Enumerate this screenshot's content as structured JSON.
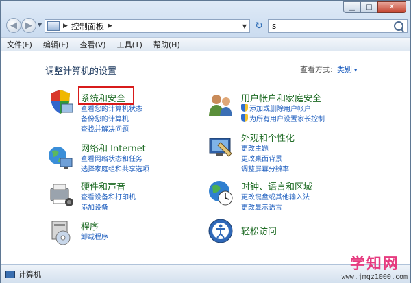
{
  "window": {
    "buttons": [
      "minimize",
      "maximize",
      "close"
    ]
  },
  "address": {
    "path": "控制面板",
    "search_value": "s"
  },
  "menu": [
    "文件(F)",
    "编辑(E)",
    "查看(V)",
    "工具(T)",
    "帮助(H)"
  ],
  "content": {
    "heading": "调整计算机的设置",
    "view_by_label": "查看方式:",
    "view_by_value": "类别",
    "categories": [
      {
        "title": "系统和安全",
        "icon": "system-security-icon",
        "links": [
          "查看您的计算机状态",
          "备份您的计算机",
          "查找并解决问题"
        ]
      },
      {
        "title": "网络和 Internet",
        "icon": "network-icon",
        "links": [
          "查看网络状态和任务",
          "选择家庭组和共享选项"
        ]
      },
      {
        "title": "硬件和声音",
        "icon": "hardware-sound-icon",
        "links": [
          "查看设备和打印机",
          "添加设备"
        ]
      },
      {
        "title": "程序",
        "icon": "programs-icon",
        "links": [
          "卸载程序"
        ]
      },
      {
        "title": "用户帐户和家庭安全",
        "icon": "user-accounts-icon",
        "links": [
          "添加或删除用户帐户",
          "为所有用户设置家长控制"
        ]
      },
      {
        "title": "外观和个性化",
        "icon": "appearance-icon",
        "links": [
          "更改主题",
          "更改桌面背景",
          "调整屏幕分辨率"
        ]
      },
      {
        "title": "时钟、语言和区域",
        "icon": "clock-language-icon",
        "links": [
          "更改键盘或其他输入法",
          "更改显示语言"
        ]
      },
      {
        "title": "轻松访问",
        "icon": "ease-of-access-icon",
        "links": []
      }
    ]
  },
  "status": {
    "text": "计算机"
  },
  "watermark": {
    "main": "学知网",
    "sub": "www.jmqz1000.com"
  },
  "colors": {
    "category_title": "#1e6b24",
    "link": "#1f5fbf",
    "highlight_box": "#d81b1b",
    "watermark": "#e63a7f"
  }
}
